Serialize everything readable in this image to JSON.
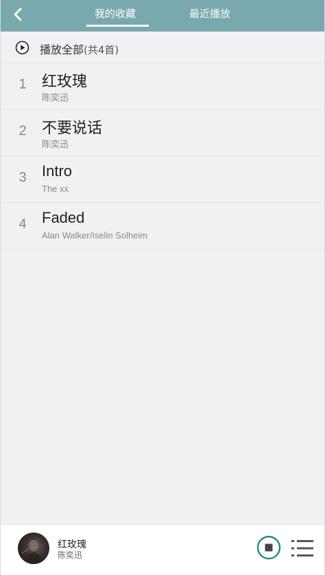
{
  "header": {
    "tabs": [
      {
        "label": "我的收藏",
        "active": true
      },
      {
        "label": "最近播放",
        "active": false
      }
    ],
    "back_icon": "chevron-left-icon"
  },
  "playall": {
    "label": "播放全部",
    "count": "(共4首)",
    "icon": "play-circle-icon"
  },
  "songs": [
    {
      "index": "1",
      "title": "红玫瑰",
      "artist": "陈奕迅"
    },
    {
      "index": "2",
      "title": "不要说话",
      "artist": "陈奕迅"
    },
    {
      "index": "3",
      "title": "Intro",
      "artist": "The xx"
    },
    {
      "index": "4",
      "title": "Faded",
      "artist": "Alan Walker/Iselin Solheim"
    }
  ],
  "player": {
    "title": "红玫瑰",
    "artist": "陈奕迅",
    "stop_icon": "stop-circle-icon",
    "list_icon": "playlist-icon"
  },
  "colors": {
    "header_bg": "#7aa8af",
    "accent": "#1f8a8a",
    "background": "#f1f1f4"
  }
}
